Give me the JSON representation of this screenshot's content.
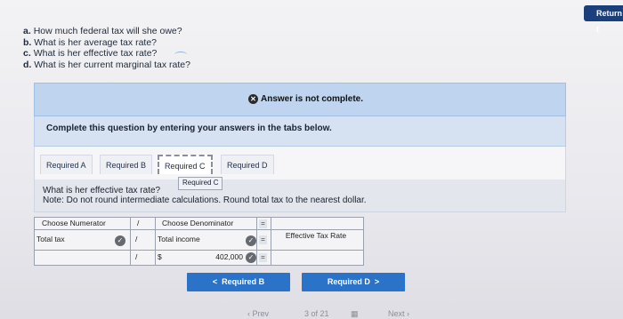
{
  "return_label": "Return t",
  "questions": {
    "a": {
      "letter": "a.",
      "text": "How much federal tax will she owe?"
    },
    "b": {
      "letter": "b.",
      "text": "What is her average tax rate?"
    },
    "c": {
      "letter": "c.",
      "text": "What is her effective tax rate?"
    },
    "d": {
      "letter": "d.",
      "text": "What is her current marginal tax rate?"
    }
  },
  "alert": {
    "text": "Answer is not complete.",
    "icon": "x-circle-icon"
  },
  "instructions": "Complete this question by entering your answers in the tabs below.",
  "tabs": [
    "Required A",
    "Required B",
    "Required C",
    "Required D"
  ],
  "active_tab_tooltip": "Required C",
  "question": {
    "text": "What is her effective tax rate?",
    "note": "Note: Do not round intermediate calculations. Round total tax to the nearest dollar."
  },
  "table": {
    "header_numerator": "Choose Numerator",
    "slash": "/",
    "header_denominator": "Choose Denominator",
    "equals": "=",
    "numerator_value": "Total tax",
    "denominator_value": "Total income",
    "currency": "$",
    "denominator_amount": "402,000",
    "result_label": "Effective Tax Rate"
  },
  "nav": {
    "prev_label": "Required B",
    "next_label": "Required D"
  },
  "pager": {
    "prev": "Prev",
    "page": "3 of 21",
    "next": "Next"
  },
  "colors": {
    "accent": "#2b73c8",
    "alert_bg": "#bfd4ee",
    "return_bg": "#1b3f7a"
  }
}
